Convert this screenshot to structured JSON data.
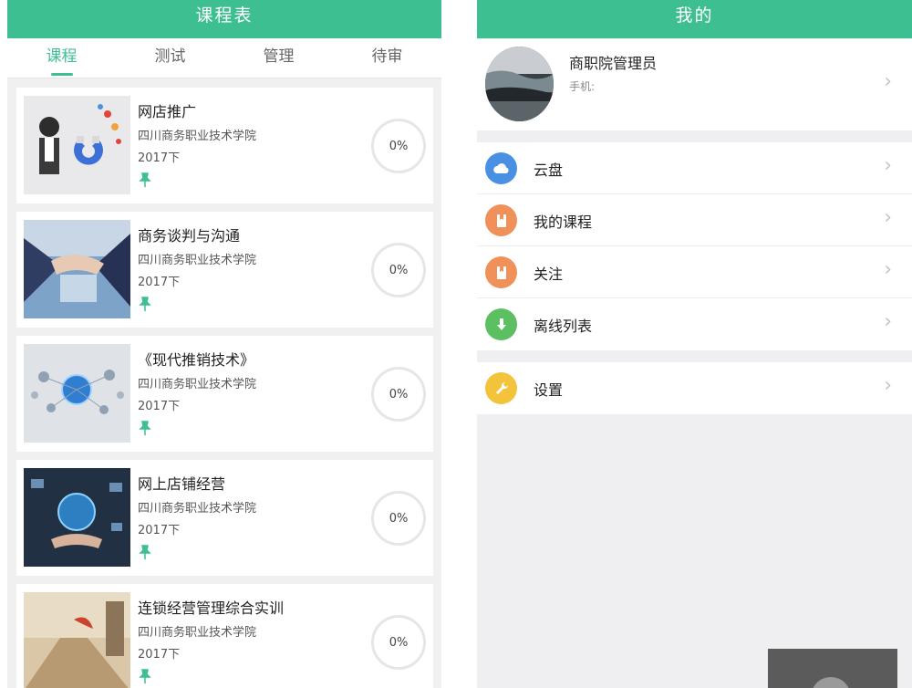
{
  "left_screen": {
    "title": "课程表",
    "tabs": [
      {
        "label": "课程",
        "active": true
      },
      {
        "label": "测试",
        "active": false
      },
      {
        "label": "管理",
        "active": false
      },
      {
        "label": "待审",
        "active": false
      }
    ],
    "courses": [
      {
        "title": "网店推广",
        "school": "四川商务职业技术学院",
        "term": "2017下",
        "progress": "0%"
      },
      {
        "title": "商务谈判与沟通",
        "school": "四川商务职业技术学院",
        "term": "2017下",
        "progress": "0%"
      },
      {
        "title": "《现代推销技术》",
        "school": "四川商务职业技术学院",
        "term": "2017下",
        "progress": "0%"
      },
      {
        "title": "网上店铺经营",
        "school": "四川商务职业技术学院",
        "term": "2017下",
        "progress": "0%"
      },
      {
        "title": "连锁经营管理综合实训",
        "school": "四川商务职业技术学院",
        "term": "2017下",
        "progress": "0%"
      }
    ]
  },
  "right_screen": {
    "title": "我的",
    "profile": {
      "name": "商职院管理员",
      "phone_label": "手机:"
    },
    "menu_groups": [
      [
        {
          "label": "云盘",
          "icon": "cloud-icon",
          "color": "#4a90e2"
        },
        {
          "label": "我的课程",
          "icon": "book-icon",
          "color": "#f0915a"
        },
        {
          "label": "关注",
          "icon": "bookmark-icon",
          "color": "#f0915a"
        },
        {
          "label": "离线列表",
          "icon": "download-icon",
          "color": "#5cbf62"
        }
      ],
      [
        {
          "label": "设置",
          "icon": "wrench-icon",
          "color": "#f2c33b"
        }
      ]
    ]
  },
  "colors": {
    "accent": "#3dbf92"
  }
}
